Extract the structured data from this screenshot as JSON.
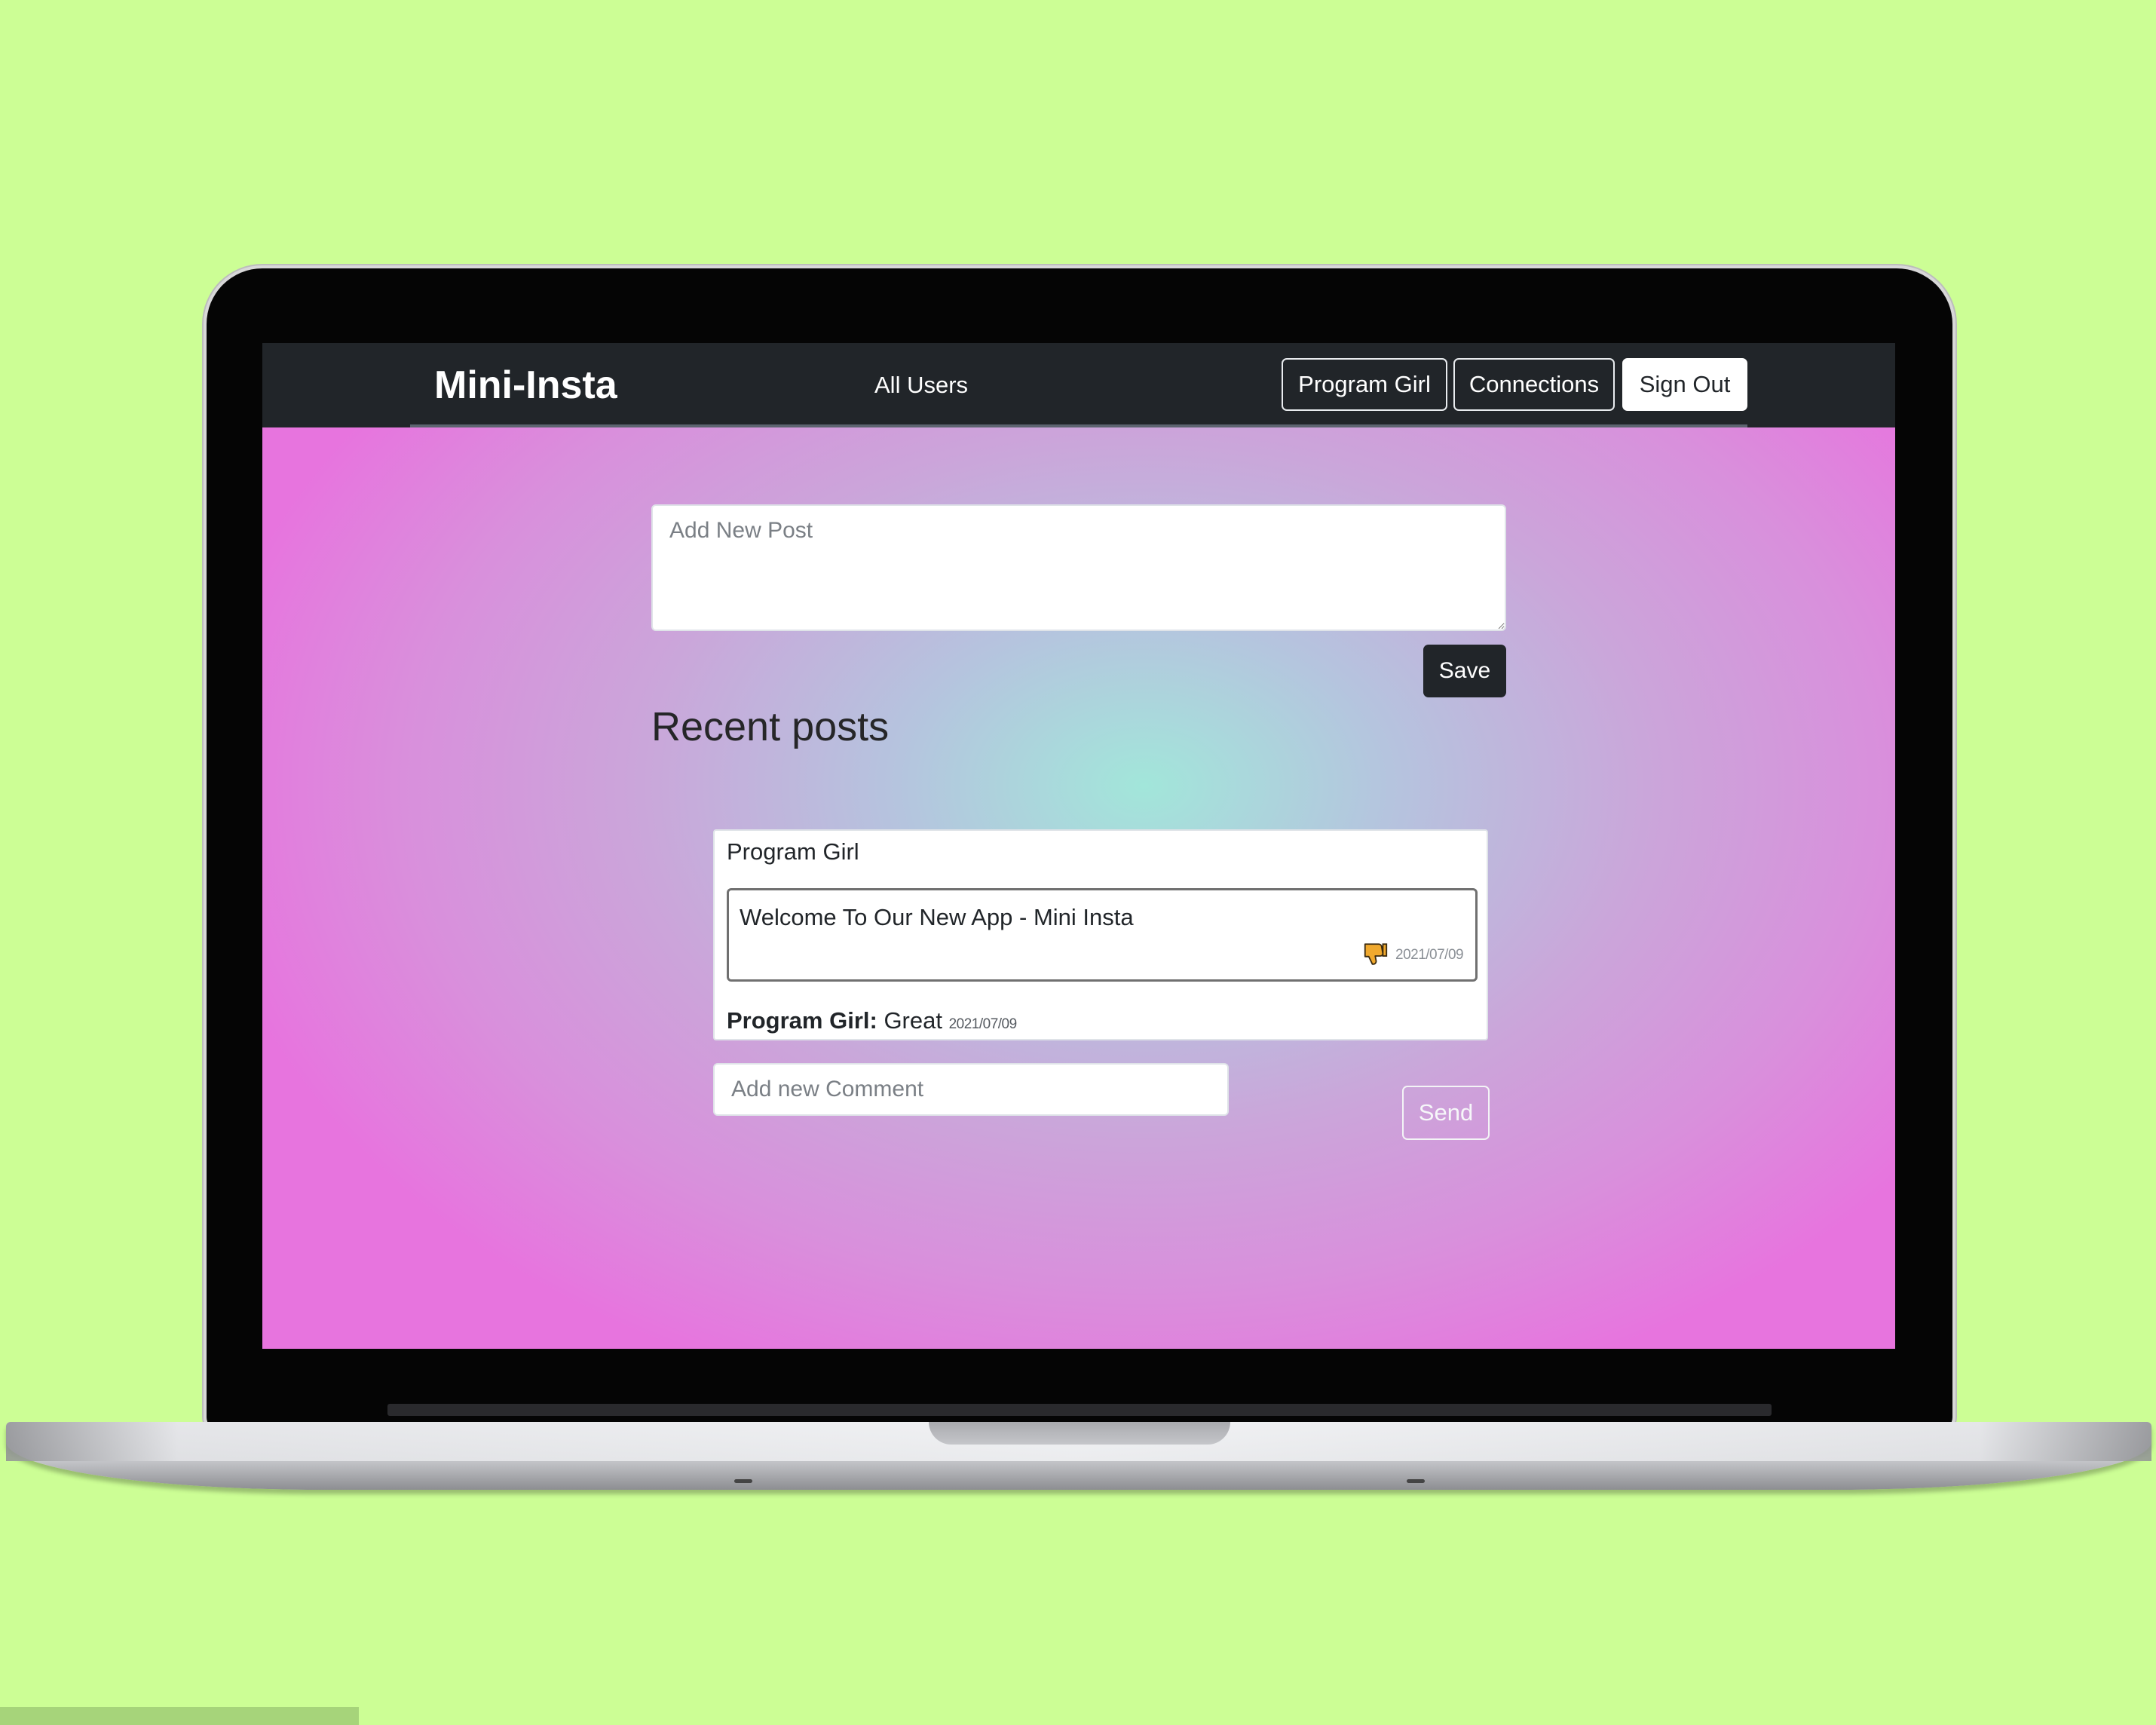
{
  "navbar": {
    "brand": "Mini-Insta",
    "links": {
      "all_users": "All Users"
    },
    "buttons": {
      "user": "Program Girl",
      "connections": "Connections",
      "sign_out": "Sign Out"
    }
  },
  "composer": {
    "placeholder": "Add New Post",
    "save_label": "Save"
  },
  "feed": {
    "title": "Recent posts",
    "posts": [
      {
        "author": "Program Girl",
        "text": "Welcome To Our New App - Mini Insta",
        "date": "2021/07/09",
        "reaction_icon": "thumbs-down-icon",
        "comments": [
          {
            "author": "Program Girl:",
            "text": " Great ",
            "date": "2021/07/09"
          }
        ]
      }
    ],
    "comment_input": {
      "placeholder": "Add new Comment",
      "send_label": "Send"
    }
  },
  "colors": {
    "page_background": "#ccfe95",
    "navbar": "#212529",
    "gradient_center": "#a2e6da",
    "gradient_edge": "#e774de",
    "reaction_icon": "#f0a92e"
  }
}
